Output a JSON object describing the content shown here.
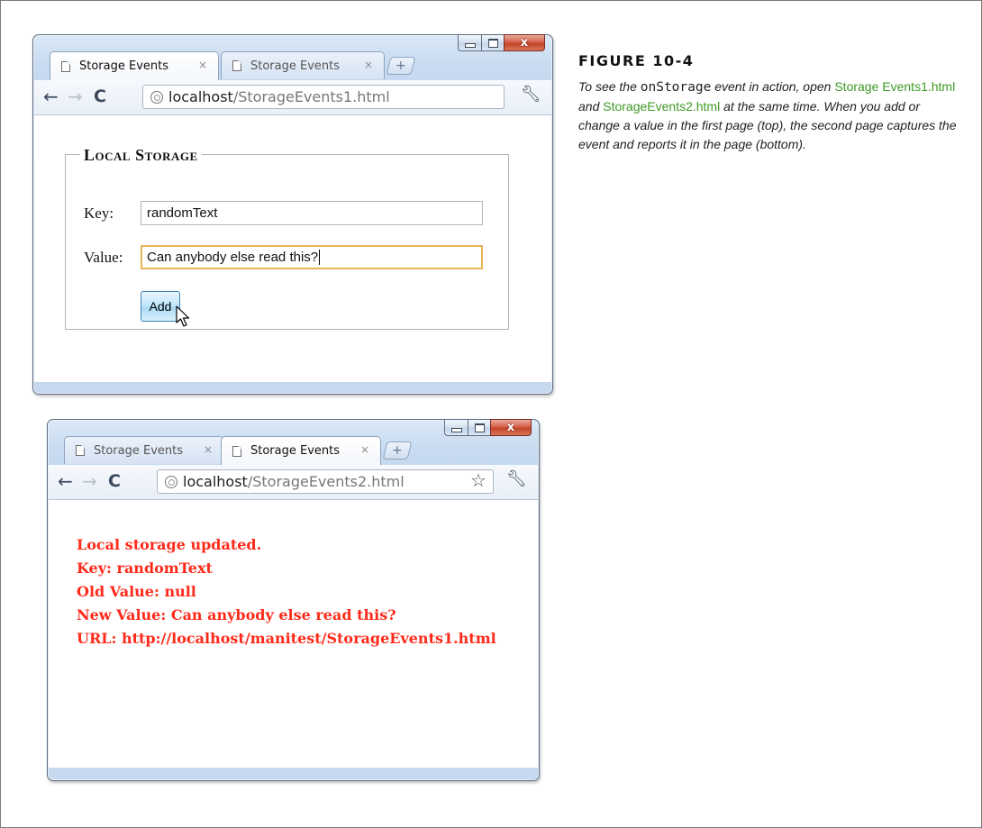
{
  "caption": {
    "title": "FIGURE 10-4",
    "text_1": "To see the ",
    "code": "onStorage",
    "text_2": " event in action, open ",
    "link_1": "Storage Events1.html",
    "text_3": " and ",
    "link_2": "StorageEvents2.html",
    "text_4": " at the same time. When you add or change a value in the first page (top), the second page captures the event and reports it in the page (bottom)."
  },
  "top_window": {
    "tabs": [
      {
        "label": "Storage Events",
        "active": true,
        "close": "×"
      },
      {
        "label": "Storage Events",
        "active": false,
        "close": "×"
      }
    ],
    "new_tab_glyph": "+",
    "url_host": "localhost",
    "url_path": "/StorageEvents1.html",
    "form": {
      "legend": "Local Storage",
      "key_label": "Key:",
      "key_value": "randomText",
      "value_label": "Value:",
      "value_value": "Can anybody else read this?",
      "add_button": "Add"
    }
  },
  "bottom_window": {
    "tabs": [
      {
        "label": "Storage Events",
        "active": false,
        "close": "×"
      },
      {
        "label": "Storage Events",
        "active": true,
        "close": "×"
      }
    ],
    "new_tab_glyph": "+",
    "url_host": "localhost",
    "url_path": "/StorageEvents2.html",
    "event_log": [
      "Local storage updated.",
      "Key: randomText",
      "Old Value: null",
      "New Value: Can anybody else read this?",
      "URL: http://localhost/manitest/StorageEvents1.html"
    ]
  },
  "window_buttons": {
    "minimize": "–",
    "maximize": "□",
    "close": "x"
  },
  "icons": [
    "page-icon",
    "back-arrow-icon",
    "forward-arrow-icon",
    "reload-icon",
    "globe-icon",
    "star-icon",
    "wrench-icon",
    "mouse-cursor-icon"
  ],
  "colors": {
    "event_text": "#ff2a1a",
    "link": "#3f9a26",
    "focus_border": "#e8b45a"
  }
}
